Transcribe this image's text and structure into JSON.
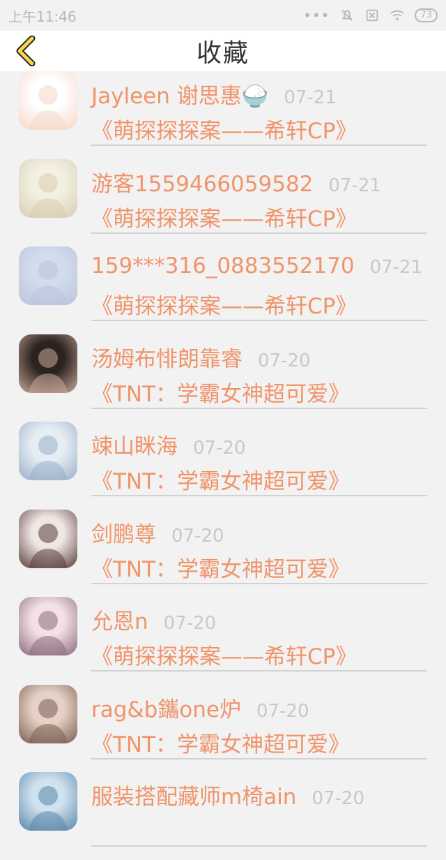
{
  "status_bar": {
    "time": "上午11:46",
    "battery": "73"
  },
  "header": {
    "title": "收藏"
  },
  "favorites": [
    {
      "name": "Jayleen 谢思惠🍚",
      "date": "07-21",
      "book": "《萌探探探案——希轩CP》",
      "avatar_colors": [
        "#ffffff",
        "#f6d7c9"
      ]
    },
    {
      "name": "游客1559466059582",
      "date": "07-21",
      "book": "《萌探探探案——希轩CP》",
      "avatar_colors": [
        "#f3f0e3",
        "#d8cdb2"
      ]
    },
    {
      "name": "159***316_0883552170",
      "date": "07-21",
      "book": "《萌探探探案——希轩CP》",
      "avatar_colors": [
        "#d3dcec",
        "#b9c5dc"
      ]
    },
    {
      "name": "汤姆布悱朗靠睿",
      "date": "07-20",
      "book": "《TNT：学霸女神超可爱》",
      "avatar_colors": [
        "#2b2320",
        "#caa79a"
      ]
    },
    {
      "name": "竦山眯海",
      "date": "07-20",
      "book": "《TNT：学霸女神超可爱》",
      "avatar_colors": [
        "#e7edf5",
        "#9ab0c7"
      ]
    },
    {
      "name": "剑鹏尊",
      "date": "07-20",
      "book": "《TNT：学霸女神超可爱》",
      "avatar_colors": [
        "#efe7e4",
        "#5a3e3b"
      ]
    },
    {
      "name": "允恩n",
      "date": "07-20",
      "book": "《萌探探探案——希轩CP》",
      "avatar_colors": [
        "#f4e1e8",
        "#8d6b7b"
      ]
    },
    {
      "name": "rag&b鑴one炉",
      "date": "07-20",
      "book": "《TNT：学霸女神超可爱》",
      "avatar_colors": [
        "#e6d1c6",
        "#7b5e52"
      ]
    },
    {
      "name": "服装搭配藏师m椅ain",
      "date": "07-20",
      "book": "",
      "avatar_colors": [
        "#cfe2f0",
        "#5b86a8"
      ]
    }
  ]
}
